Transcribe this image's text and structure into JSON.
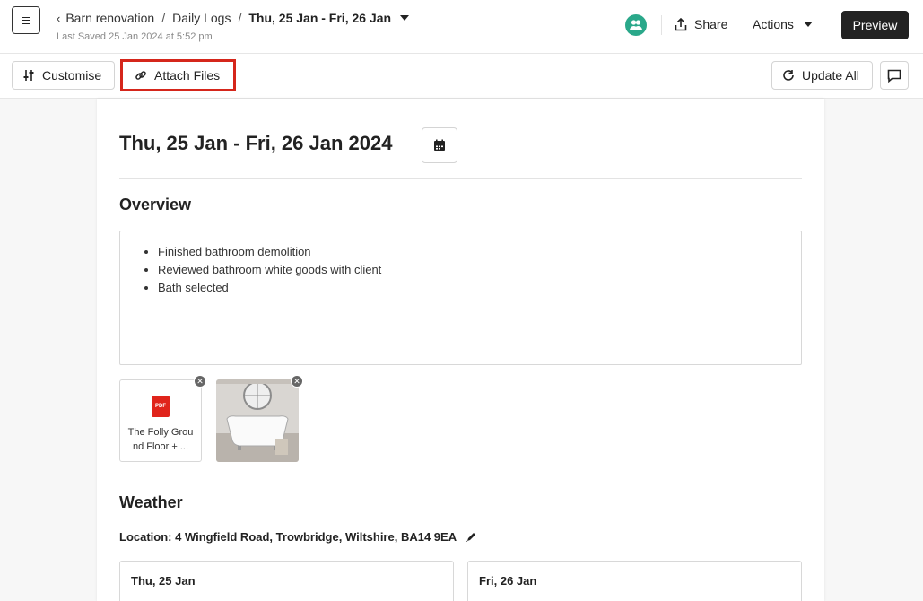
{
  "header": {
    "breadcrumbs": [
      "Barn renovation",
      "Daily Logs"
    ],
    "current_page": "Thu, 25 Jan - Fri, 26 Jan",
    "last_saved": "Last Saved 25 Jan 2024 at 5:52 pm",
    "share_label": "Share",
    "actions_label": "Actions",
    "preview_label": "Preview"
  },
  "toolbar": {
    "customise_label": "Customise",
    "attach_label": "Attach Files",
    "update_all_label": "Update All"
  },
  "log": {
    "title": "Thu, 25 Jan - Fri, 26 Jan 2024",
    "overview_heading": "Overview",
    "overview_items": [
      "Finished bathroom demolition",
      "Reviewed bathroom white goods with client",
      "Bath selected"
    ],
    "attachments": [
      {
        "type": "pdf",
        "name": "The Folly Ground Floor + ...",
        "icon_text": "PDF"
      },
      {
        "type": "image",
        "name": "bathtub photo"
      }
    ],
    "weather_heading": "Weather",
    "location_text": "Location: 4 Wingfield Road, Trowbridge, Wiltshire, BA14 9EA",
    "days": [
      "Thu, 25 Jan",
      "Fri, 26 Jan"
    ]
  },
  "colors": {
    "accent_highlight": "#d5261b",
    "team_icon": "#2aa88a",
    "pdf_red": "#e0241b",
    "preview_bg": "#222222"
  }
}
